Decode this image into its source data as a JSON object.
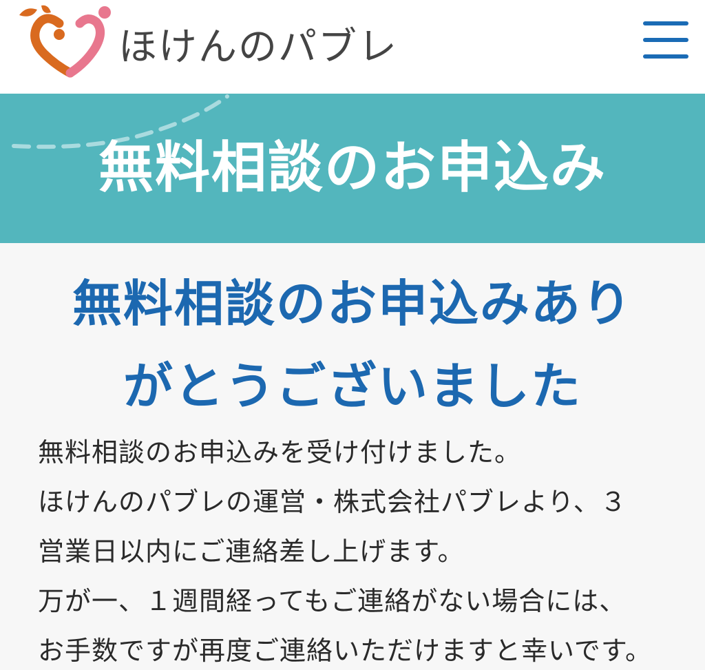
{
  "header": {
    "site_name": "ほけんのパブレ",
    "logo_icon": "heart-logo-icon",
    "menu_icon": "hamburger-menu-icon"
  },
  "banner": {
    "title": "無料相談のお申込み"
  },
  "main": {
    "heading_line1": "無料相談のお申込みあり",
    "heading_line2": "がとうございました",
    "paragraphs": [
      "無料相談のお申込みを受け付けました。",
      "ほけんのパブレの運営・株式会社パブレより、３",
      "営業日以内にご連絡差し上げます。",
      "万が一、１週間経ってもご連絡がない場合には、",
      "お手数ですが再度ご連絡いただけますと幸いです。"
    ]
  },
  "colors": {
    "brand_blue": "#1c68b0",
    "banner_teal": "#53b6bd",
    "logo_orange": "#d96a1f",
    "logo_pink": "#e8778e"
  }
}
